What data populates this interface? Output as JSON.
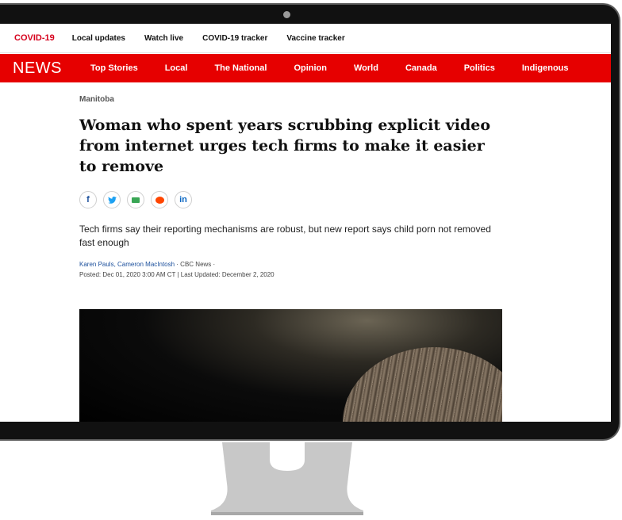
{
  "covid_bar": {
    "label": "COVID-19",
    "links": [
      "Local updates",
      "Watch live",
      "COVID-19 tracker",
      "Vaccine tracker"
    ]
  },
  "nav": {
    "brand": "NEWS",
    "items": [
      "Top Stories",
      "Local",
      "The National",
      "Opinion",
      "World",
      "Canada",
      "Politics",
      "Indigenous"
    ]
  },
  "article": {
    "section": "Manitoba",
    "headline": "Woman who spent years scrubbing explicit video from internet urges tech firms to make it easier to remove",
    "share_icons": [
      "facebook-icon",
      "twitter-icon",
      "email-icon",
      "reddit-icon",
      "linkedin-icon"
    ],
    "share_glyphs": {
      "facebook": "f",
      "twitter": "✔",
      "linkedin": "in"
    },
    "dek": "Tech firms say their reporting mechanisms are robust, but new report says child porn not removed fast enough",
    "authors": "Karen Pauls, Cameron MacIntosh",
    "outlet": " · CBC News ·",
    "posted": "Posted: Dec 01, 2020 3:00 AM CT | Last Updated: December 2, 2020"
  },
  "colors": {
    "brand_red": "#e60000",
    "covid_red": "#d6001c",
    "bezel": "#111111"
  }
}
